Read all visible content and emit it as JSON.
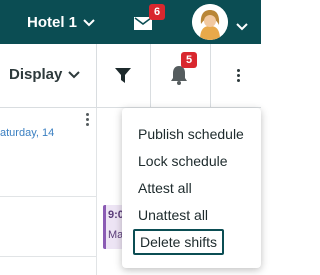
{
  "header": {
    "hotel_name": "Hotel 1",
    "mail_count": "6",
    "colors": {
      "bar": "#0b4d53",
      "badge": "#d9272e"
    }
  },
  "toolbar": {
    "display_label": "Display",
    "notification_count": "5"
  },
  "calendar": {
    "day_label": "aturday, 14",
    "shift_time": "9:0",
    "shift_name": "Mar"
  },
  "menu": {
    "items": [
      {
        "label": "Publish schedule"
      },
      {
        "label": "Lock schedule"
      },
      {
        "label": "Attest all"
      },
      {
        "label": "Unattest all"
      },
      {
        "label": "Delete shifts"
      }
    ]
  }
}
